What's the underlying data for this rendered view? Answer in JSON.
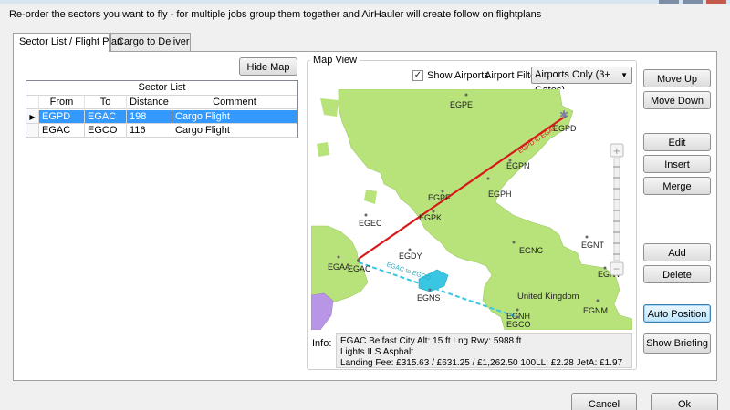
{
  "instructions": "Re-order the sectors you want to fly - for multiple jobs group them together and AirHauler will create follow on flightplans",
  "tabs": [
    {
      "label": "Sector List / Flight Plan",
      "active": true
    },
    {
      "label": "Cargo to Deliver",
      "active": false
    }
  ],
  "left": {
    "hide_map_label": "Hide Map",
    "sector_list": {
      "title": "Sector List",
      "columns": [
        "From",
        "To",
        "Distance",
        "Comment"
      ],
      "rows": [
        {
          "from": "EGPD",
          "to": "EGAC",
          "distance": "198",
          "comment": "Cargo Flight",
          "selected": true,
          "indicator": "▶"
        },
        {
          "from": "EGAC",
          "to": "EGCO",
          "distance": "116",
          "comment": "Cargo Flight",
          "selected": false,
          "indicator": ""
        }
      ]
    }
  },
  "map_panel": {
    "group_label": "Map View",
    "show_airports_label": "Show Airports",
    "show_airports_checked": true,
    "checkmark": "✓",
    "airport_filter_label": "Airport Filter",
    "airport_filter_value": "Airports Only (3+ Gates)",
    "dropdown_arrow": "▼",
    "zoom_plus": "+",
    "zoom_minus": "−",
    "airports": [
      "EGPE",
      "EGPD",
      "EGPN",
      "EGPF",
      "EGPH",
      "EGPK",
      "EGEC",
      "EGAC",
      "EGAA",
      "EGDY",
      "EGNC",
      "EGNT",
      "EGNS",
      "EGNH",
      "EGCO",
      "EGNM",
      "EGNV"
    ],
    "place_labels": [
      "United Kingdom"
    ],
    "route_labels": [
      "EGPD to EGAC",
      "EGAC to EGCO"
    ],
    "colors": {
      "land": "#b8e37a",
      "other_land": "#b995e6",
      "water": "#ffffff",
      "route_active": "#d8191b",
      "route_next": "#39c6e3"
    },
    "info_label": "Info:",
    "info_lines": [
      "EGAC Belfast City  Alt: 15 ft  Lng Rwy: 5988 ft",
      "Lights ILS Asphalt",
      "Landing Fee: £315.63 / £631.25 / £1,262.50   100LL: £2.28  JetA: £1.97"
    ]
  },
  "right_buttons": {
    "move_up": "Move Up",
    "move_down": "Move Down",
    "edit": "Edit",
    "insert": "Insert",
    "merge": "Merge",
    "add": "Add",
    "delete": "Delete",
    "auto_position": "Auto Position",
    "show_briefing": "Show Briefing"
  },
  "footer": {
    "cancel": "Cancel",
    "ok": "Ok"
  }
}
